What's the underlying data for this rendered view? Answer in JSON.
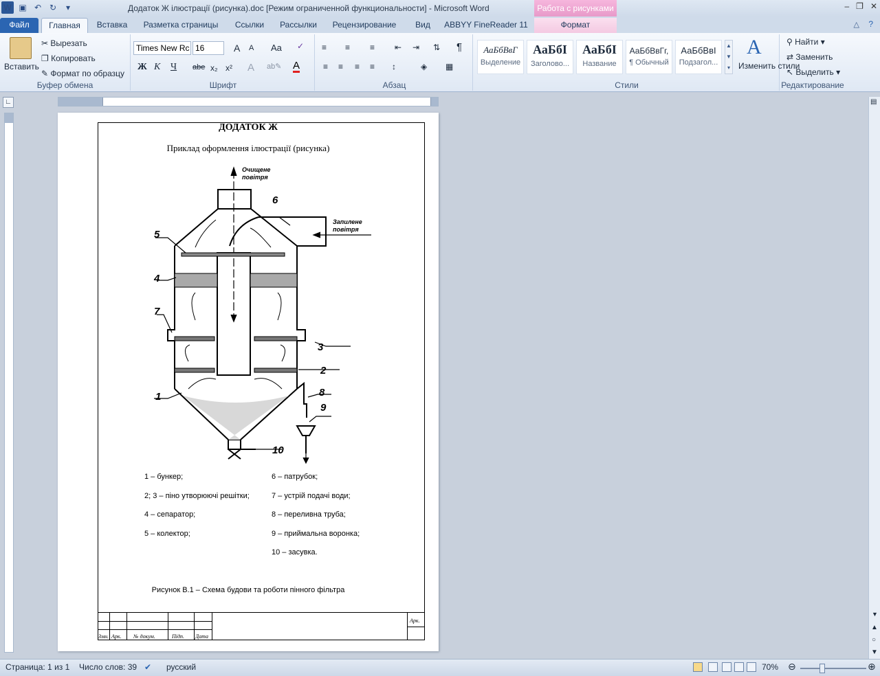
{
  "window": {
    "title": "Додаток Ж ілюстрації (рисунка).doc [Режим ограниченной функциональности]  -  Microsoft Word",
    "context_tab_group": "Работа с рисунками"
  },
  "tabs": [
    {
      "label": "Файл"
    },
    {
      "label": "Главная"
    },
    {
      "label": "Вставка"
    },
    {
      "label": "Разметка страницы"
    },
    {
      "label": "Ссылки"
    },
    {
      "label": "Рассылки"
    },
    {
      "label": "Рецензирование"
    },
    {
      "label": "Вид"
    },
    {
      "label": "ABBYY FineReader 11"
    },
    {
      "label": "Формат"
    }
  ],
  "ribbon": {
    "clipboard": {
      "paste": "Вставить",
      "cut": "Вырезать",
      "copy": "Копировать",
      "format_painter": "Формат по образцу",
      "group": "Буфер обмена"
    },
    "font": {
      "name": "Times New Rc",
      "size": "16",
      "group": "Шрифт",
      "bold": "Ж",
      "italic": "К",
      "underline": "Ч",
      "strike": "abe",
      "sub": "x₂",
      "sup": "x²",
      "grow": "A",
      "shrink": "A",
      "case": "Aa",
      "color": "A"
    },
    "paragraph": {
      "group": "Абзац"
    },
    "styles": {
      "group": "Стили",
      "items": [
        {
          "sample": "АаБбВвГ",
          "name": "Выделение"
        },
        {
          "sample": "АаБбI",
          "name": "Заголово..."
        },
        {
          "sample": "АаБбI",
          "name": "Название"
        },
        {
          "sample": "АаБбВвГг,",
          "name": "¶ Обычный"
        },
        {
          "sample": "АаБбВвI",
          "name": "Подзагол..."
        }
      ],
      "change": "Изменить стили"
    },
    "editing": {
      "group": "Редактирование",
      "find": "Найти",
      "replace": "Заменить",
      "select": "Выделить"
    }
  },
  "document": {
    "heading": "ДОДАТОК  Ж",
    "subheading": "Приклад оформлення ілюстрації (рисунка)",
    "figure_labels": {
      "clean_air": "Очищене повітря",
      "dusty_air": "Запилене повітря",
      "n1": "1",
      "n2": "2",
      "n3": "3",
      "n4": "4",
      "n5": "5",
      "n6": "6",
      "n7": "7",
      "n8": "8",
      "n9": "9",
      "n10": "10"
    },
    "legend_left": [
      "1 – бункер;",
      "2; 3 – піно утворюючі решітки;",
      "4 – сепаратор;",
      "5 – колектор;"
    ],
    "legend_right": [
      "6 – патрубок;",
      "7 – устрій подачі води;",
      "8 – переливна труба;",
      "9 – приймальна воронка;",
      "10 – засувка."
    ],
    "caption": "Рисунок В.1 – Схема будови та роботи пінного фільтра",
    "stamp": {
      "zm": "Змн.",
      "ark": "Арк.",
      "doc": "№ докум.",
      "sign": "Підп.",
      "date": "Дата",
      "sheet": "Арк."
    }
  },
  "status": {
    "page": "Страница: 1 из 1",
    "words": "Число слов: 39",
    "lang": "русский",
    "zoom": "70%",
    "zoom_value": 70
  },
  "colors": {
    "file_tab": "#2b65b2",
    "context_tab": "#e89ac9",
    "accent": "#2b5797"
  }
}
